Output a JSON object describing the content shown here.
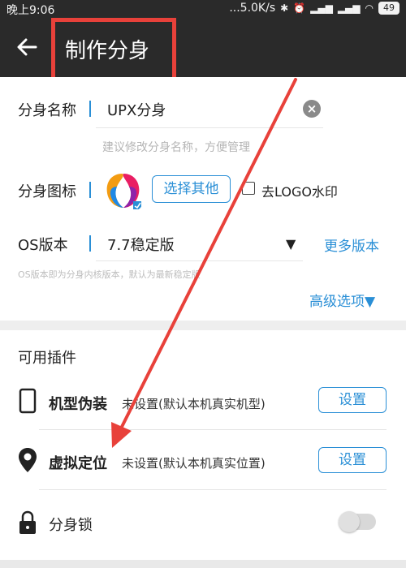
{
  "status_bar": {
    "time": "晚上9:06",
    "net_speed": "...5.0K/s",
    "battery": "49"
  },
  "app_bar": {
    "title": "制作分身"
  },
  "form": {
    "name_label": "分身名称",
    "name_value": "UPX分身",
    "name_hint": "建议修改分身名称，方便管理",
    "icon_label": "分身图标",
    "choose_button": "选择其他",
    "logo_checkbox_label": "去LOGO水印",
    "logo_checkbox_checked": false,
    "os_label": "OS版本",
    "os_value": "7.7稳定版",
    "more_versions": "更多版本",
    "os_hint": "OS版本即为分身内核版本，默认为最新稳定版",
    "advanced": "高级选项▼"
  },
  "plugins": {
    "title": "可用插件",
    "items": [
      {
        "name": "机型伪装",
        "status": "未设置(默认本机真实机型)",
        "button": "设置",
        "icon": "phone-icon"
      },
      {
        "name": "虚拟定位",
        "status": "未设置(默认本机真实位置)",
        "button": "设置",
        "icon": "location-pin-icon"
      },
      {
        "name": "分身锁",
        "icon": "lock-icon",
        "toggle_on": false
      }
    ]
  },
  "colors": {
    "accent": "#2a8fd6",
    "app_bar": "#2a2a2a",
    "annotation": "#e8413a"
  }
}
